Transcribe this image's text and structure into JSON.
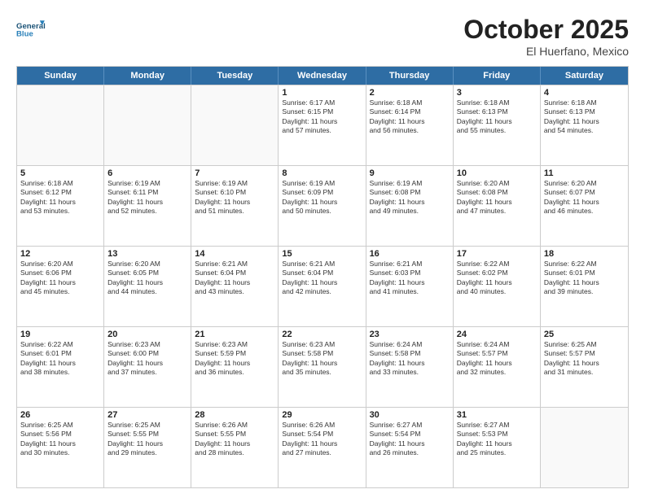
{
  "header": {
    "logo_line1": "General",
    "logo_line2": "Blue",
    "month": "October 2025",
    "location": "El Huerfano, Mexico"
  },
  "days_of_week": [
    "Sunday",
    "Monday",
    "Tuesday",
    "Wednesday",
    "Thursday",
    "Friday",
    "Saturday"
  ],
  "weeks": [
    [
      {
        "day": "",
        "empty": true
      },
      {
        "day": "",
        "empty": true
      },
      {
        "day": "",
        "empty": true
      },
      {
        "day": "1",
        "line1": "Sunrise: 6:17 AM",
        "line2": "Sunset: 6:15 PM",
        "line3": "Daylight: 11 hours",
        "line4": "and 57 minutes."
      },
      {
        "day": "2",
        "line1": "Sunrise: 6:18 AM",
        "line2": "Sunset: 6:14 PM",
        "line3": "Daylight: 11 hours",
        "line4": "and 56 minutes."
      },
      {
        "day": "3",
        "line1": "Sunrise: 6:18 AM",
        "line2": "Sunset: 6:13 PM",
        "line3": "Daylight: 11 hours",
        "line4": "and 55 minutes."
      },
      {
        "day": "4",
        "line1": "Sunrise: 6:18 AM",
        "line2": "Sunset: 6:13 PM",
        "line3": "Daylight: 11 hours",
        "line4": "and 54 minutes."
      }
    ],
    [
      {
        "day": "5",
        "line1": "Sunrise: 6:18 AM",
        "line2": "Sunset: 6:12 PM",
        "line3": "Daylight: 11 hours",
        "line4": "and 53 minutes."
      },
      {
        "day": "6",
        "line1": "Sunrise: 6:19 AM",
        "line2": "Sunset: 6:11 PM",
        "line3": "Daylight: 11 hours",
        "line4": "and 52 minutes."
      },
      {
        "day": "7",
        "line1": "Sunrise: 6:19 AM",
        "line2": "Sunset: 6:10 PM",
        "line3": "Daylight: 11 hours",
        "line4": "and 51 minutes."
      },
      {
        "day": "8",
        "line1": "Sunrise: 6:19 AM",
        "line2": "Sunset: 6:09 PM",
        "line3": "Daylight: 11 hours",
        "line4": "and 50 minutes."
      },
      {
        "day": "9",
        "line1": "Sunrise: 6:19 AM",
        "line2": "Sunset: 6:08 PM",
        "line3": "Daylight: 11 hours",
        "line4": "and 49 minutes."
      },
      {
        "day": "10",
        "line1": "Sunrise: 6:20 AM",
        "line2": "Sunset: 6:08 PM",
        "line3": "Daylight: 11 hours",
        "line4": "and 47 minutes."
      },
      {
        "day": "11",
        "line1": "Sunrise: 6:20 AM",
        "line2": "Sunset: 6:07 PM",
        "line3": "Daylight: 11 hours",
        "line4": "and 46 minutes."
      }
    ],
    [
      {
        "day": "12",
        "line1": "Sunrise: 6:20 AM",
        "line2": "Sunset: 6:06 PM",
        "line3": "Daylight: 11 hours",
        "line4": "and 45 minutes."
      },
      {
        "day": "13",
        "line1": "Sunrise: 6:20 AM",
        "line2": "Sunset: 6:05 PM",
        "line3": "Daylight: 11 hours",
        "line4": "and 44 minutes."
      },
      {
        "day": "14",
        "line1": "Sunrise: 6:21 AM",
        "line2": "Sunset: 6:04 PM",
        "line3": "Daylight: 11 hours",
        "line4": "and 43 minutes."
      },
      {
        "day": "15",
        "line1": "Sunrise: 6:21 AM",
        "line2": "Sunset: 6:04 PM",
        "line3": "Daylight: 11 hours",
        "line4": "and 42 minutes."
      },
      {
        "day": "16",
        "line1": "Sunrise: 6:21 AM",
        "line2": "Sunset: 6:03 PM",
        "line3": "Daylight: 11 hours",
        "line4": "and 41 minutes."
      },
      {
        "day": "17",
        "line1": "Sunrise: 6:22 AM",
        "line2": "Sunset: 6:02 PM",
        "line3": "Daylight: 11 hours",
        "line4": "and 40 minutes."
      },
      {
        "day": "18",
        "line1": "Sunrise: 6:22 AM",
        "line2": "Sunset: 6:01 PM",
        "line3": "Daylight: 11 hours",
        "line4": "and 39 minutes."
      }
    ],
    [
      {
        "day": "19",
        "line1": "Sunrise: 6:22 AM",
        "line2": "Sunset: 6:01 PM",
        "line3": "Daylight: 11 hours",
        "line4": "and 38 minutes."
      },
      {
        "day": "20",
        "line1": "Sunrise: 6:23 AM",
        "line2": "Sunset: 6:00 PM",
        "line3": "Daylight: 11 hours",
        "line4": "and 37 minutes."
      },
      {
        "day": "21",
        "line1": "Sunrise: 6:23 AM",
        "line2": "Sunset: 5:59 PM",
        "line3": "Daylight: 11 hours",
        "line4": "and 36 minutes."
      },
      {
        "day": "22",
        "line1": "Sunrise: 6:23 AM",
        "line2": "Sunset: 5:58 PM",
        "line3": "Daylight: 11 hours",
        "line4": "and 35 minutes."
      },
      {
        "day": "23",
        "line1": "Sunrise: 6:24 AM",
        "line2": "Sunset: 5:58 PM",
        "line3": "Daylight: 11 hours",
        "line4": "and 33 minutes."
      },
      {
        "day": "24",
        "line1": "Sunrise: 6:24 AM",
        "line2": "Sunset: 5:57 PM",
        "line3": "Daylight: 11 hours",
        "line4": "and 32 minutes."
      },
      {
        "day": "25",
        "line1": "Sunrise: 6:25 AM",
        "line2": "Sunset: 5:57 PM",
        "line3": "Daylight: 11 hours",
        "line4": "and 31 minutes."
      }
    ],
    [
      {
        "day": "26",
        "line1": "Sunrise: 6:25 AM",
        "line2": "Sunset: 5:56 PM",
        "line3": "Daylight: 11 hours",
        "line4": "and 30 minutes."
      },
      {
        "day": "27",
        "line1": "Sunrise: 6:25 AM",
        "line2": "Sunset: 5:55 PM",
        "line3": "Daylight: 11 hours",
        "line4": "and 29 minutes."
      },
      {
        "day": "28",
        "line1": "Sunrise: 6:26 AM",
        "line2": "Sunset: 5:55 PM",
        "line3": "Daylight: 11 hours",
        "line4": "and 28 minutes."
      },
      {
        "day": "29",
        "line1": "Sunrise: 6:26 AM",
        "line2": "Sunset: 5:54 PM",
        "line3": "Daylight: 11 hours",
        "line4": "and 27 minutes."
      },
      {
        "day": "30",
        "line1": "Sunrise: 6:27 AM",
        "line2": "Sunset: 5:54 PM",
        "line3": "Daylight: 11 hours",
        "line4": "and 26 minutes."
      },
      {
        "day": "31",
        "line1": "Sunrise: 6:27 AM",
        "line2": "Sunset: 5:53 PM",
        "line3": "Daylight: 11 hours",
        "line4": "and 25 minutes."
      },
      {
        "day": "",
        "empty": true
      }
    ]
  ]
}
